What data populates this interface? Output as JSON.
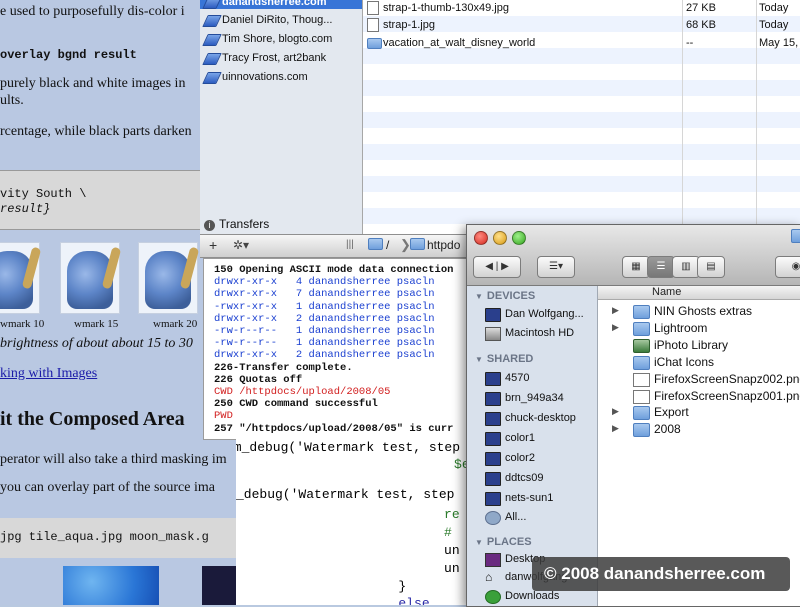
{
  "webpage": {
    "lines": [
      "e used to purposefully dis-color i",
      "overlay bgnd result",
      " purely black and white images in",
      "ults.",
      "rcentage, while black parts darken"
    ],
    "code_lines": [
      "vity South \\",
      "result}"
    ],
    "thumb_labels": [
      "wmark 10",
      "wmark 15",
      "wmark 20"
    ],
    "brightness_text": "brightness of about about 15 to 30",
    "link_text": "king with Images",
    "heading": "it the Composed Area",
    "para1": "perator will also take a third masking im",
    "para2": " you can overlay part of the source ima",
    "file_line": "jpg    tile_aqua.jpg  moon_mask.g"
  },
  "ftp": {
    "bookmarks": [
      "danandsherree.com",
      "Daniel DiRito, Thoug...",
      "Tim Shore, blogto.com",
      "Tracy Frost, art2bank",
      "uinnovations.com"
    ],
    "transfers_label": "Transfers",
    "path_root": "/",
    "path_folder": "httpdo",
    "files": [
      {
        "name": "strap-1-thumb-130x49.jpg",
        "size": "27 KB",
        "date": "Today"
      },
      {
        "name": "strap-1.jpg",
        "size": "68 KB",
        "date": "Today"
      },
      {
        "name": "vacation_at_walt_disney_world",
        "size": "--",
        "date": "May 15,"
      }
    ],
    "console": [
      {
        "text": "150 Opening ASCII mode data connection",
        "color": "#111111",
        "bold": true
      },
      {
        "text": "drwxr-xr-x   4 danandsherree psacln",
        "color": "#1a3fd0",
        "bold": false
      },
      {
        "text": "drwxr-xr-x   7 danandsherree psacln",
        "color": "#1a3fd0",
        "bold": false
      },
      {
        "text": "-rwxr-xr-x   1 danandsherree psacln",
        "color": "#1a3fd0",
        "bold": false
      },
      {
        "text": "drwxr-xr-x   2 danandsherree psacln",
        "color": "#1a3fd0",
        "bold": false
      },
      {
        "text": "-rw-r--r--   1 danandsherree psacln",
        "color": "#1a3fd0",
        "bold": false
      },
      {
        "text": "-rw-r--r--   1 danandsherree psacln",
        "color": "#1a3fd0",
        "bold": false
      },
      {
        "text": "drwxr-xr-x   2 danandsherree psacln",
        "color": "#1a3fd0",
        "bold": false
      },
      {
        "text": "226-Transfer complete.",
        "color": "#111111",
        "bold": true
      },
      {
        "text": "226 Quotas off",
        "color": "#111111",
        "bold": true
      },
      {
        "text": "CWD /httpdocs/upload/2008/05",
        "color": "#d22020",
        "bold": false
      },
      {
        "text": "250 CWD command successful",
        "color": "#111111",
        "bold": true
      },
      {
        "text": "PWD",
        "color": "#d22020",
        "bold": false
      },
      {
        "text": "257 \"/httpdocs/upload/2008/05\" is curr",
        "color": "#111111",
        "bold": true
      }
    ]
  },
  "editor": {
    "lines": [
      "im_debug('Watermark test, step",
      "          $e",
      "_debug('Watermark test, step",
      "          re",
      "          #",
      "          un",
      "          un",
      "        }",
      "        else"
    ]
  },
  "finder": {
    "sections": {
      "devices": "DEVICES",
      "shared": "SHARED",
      "places": "PLACES"
    },
    "devices": [
      "Dan Wolfgang...",
      "Macintosh HD"
    ],
    "shared": [
      "4570",
      "brn_949a34",
      "chuck-desktop",
      "color1",
      "color2",
      "ddtcs09",
      "nets-sun1",
      "All..."
    ],
    "places": [
      "Desktop",
      "danwolfgang",
      "Downloads"
    ],
    "column_name": "Name",
    "items": [
      {
        "name": "NIN Ghosts extras",
        "type": "folder",
        "expandable": true
      },
      {
        "name": "Lightroom",
        "type": "folder",
        "expandable": true
      },
      {
        "name": "iPhoto Library",
        "type": "app",
        "expandable": false
      },
      {
        "name": "iChat Icons",
        "type": "folder",
        "expandable": false
      },
      {
        "name": "FirefoxScreenSnapz002.png",
        "type": "doc",
        "expandable": false
      },
      {
        "name": "FirefoxScreenSnapz001.png",
        "type": "doc",
        "expandable": false
      },
      {
        "name": "Export",
        "type": "folder",
        "expandable": true
      },
      {
        "name": "2008",
        "type": "folder",
        "expandable": true
      }
    ]
  },
  "watermark": "© 2008 danandsherree.com",
  "colors": {
    "selection": "#3875d7",
    "console_blue": "#1a3fd0",
    "console_red": "#d22020",
    "sidebar": "#d9e1ec"
  }
}
